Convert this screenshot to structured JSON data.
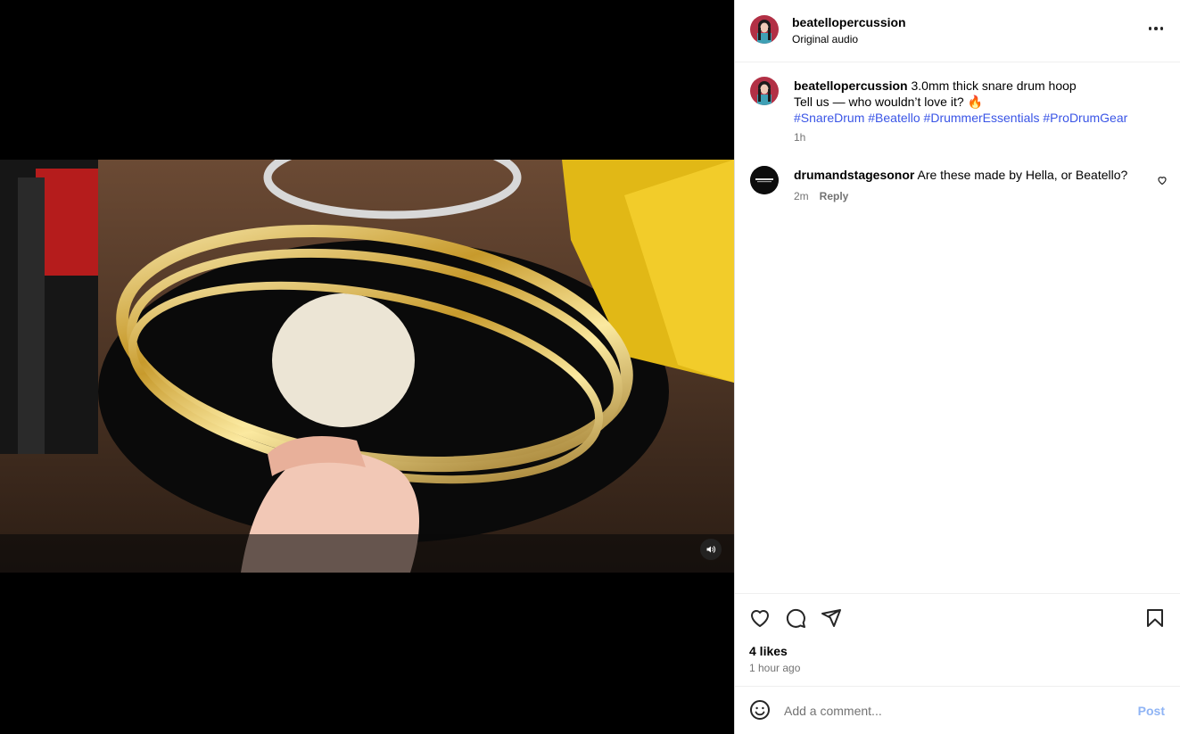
{
  "post": {
    "username": "beatellopercussion",
    "audio": "Original audio",
    "caption": {
      "username": "beatellopercussion",
      "line1": "3.0mm thick snare drum hoop",
      "line2": "Tell us — who wouldn’t love it? 🔥",
      "hashtags": [
        "#SnareDrum",
        "#Beatello",
        "#DrummerEssentials",
        "#ProDrumGear"
      ],
      "time": "1h"
    },
    "comments": [
      {
        "username": "drumandstagesonor",
        "text": "Are these made by Hella, or Beatello?",
        "time": "2m",
        "reply_label": "Reply"
      }
    ],
    "likes": "4 likes",
    "time_ago": "1 hour ago"
  },
  "input": {
    "placeholder": "Add a comment...",
    "post_label": "Post"
  },
  "icons": {
    "more": "more-horizontal-icon",
    "like": "heart-icon",
    "comment": "comment-bubble-icon",
    "share": "paper-plane-icon",
    "save": "bookmark-icon",
    "emoji": "smiley-icon",
    "volume": "volume-icon"
  },
  "colors": {
    "hashtag": "#3a55e6",
    "post_button_disabled": "#8fb4f5",
    "muted_text": "#737373"
  }
}
